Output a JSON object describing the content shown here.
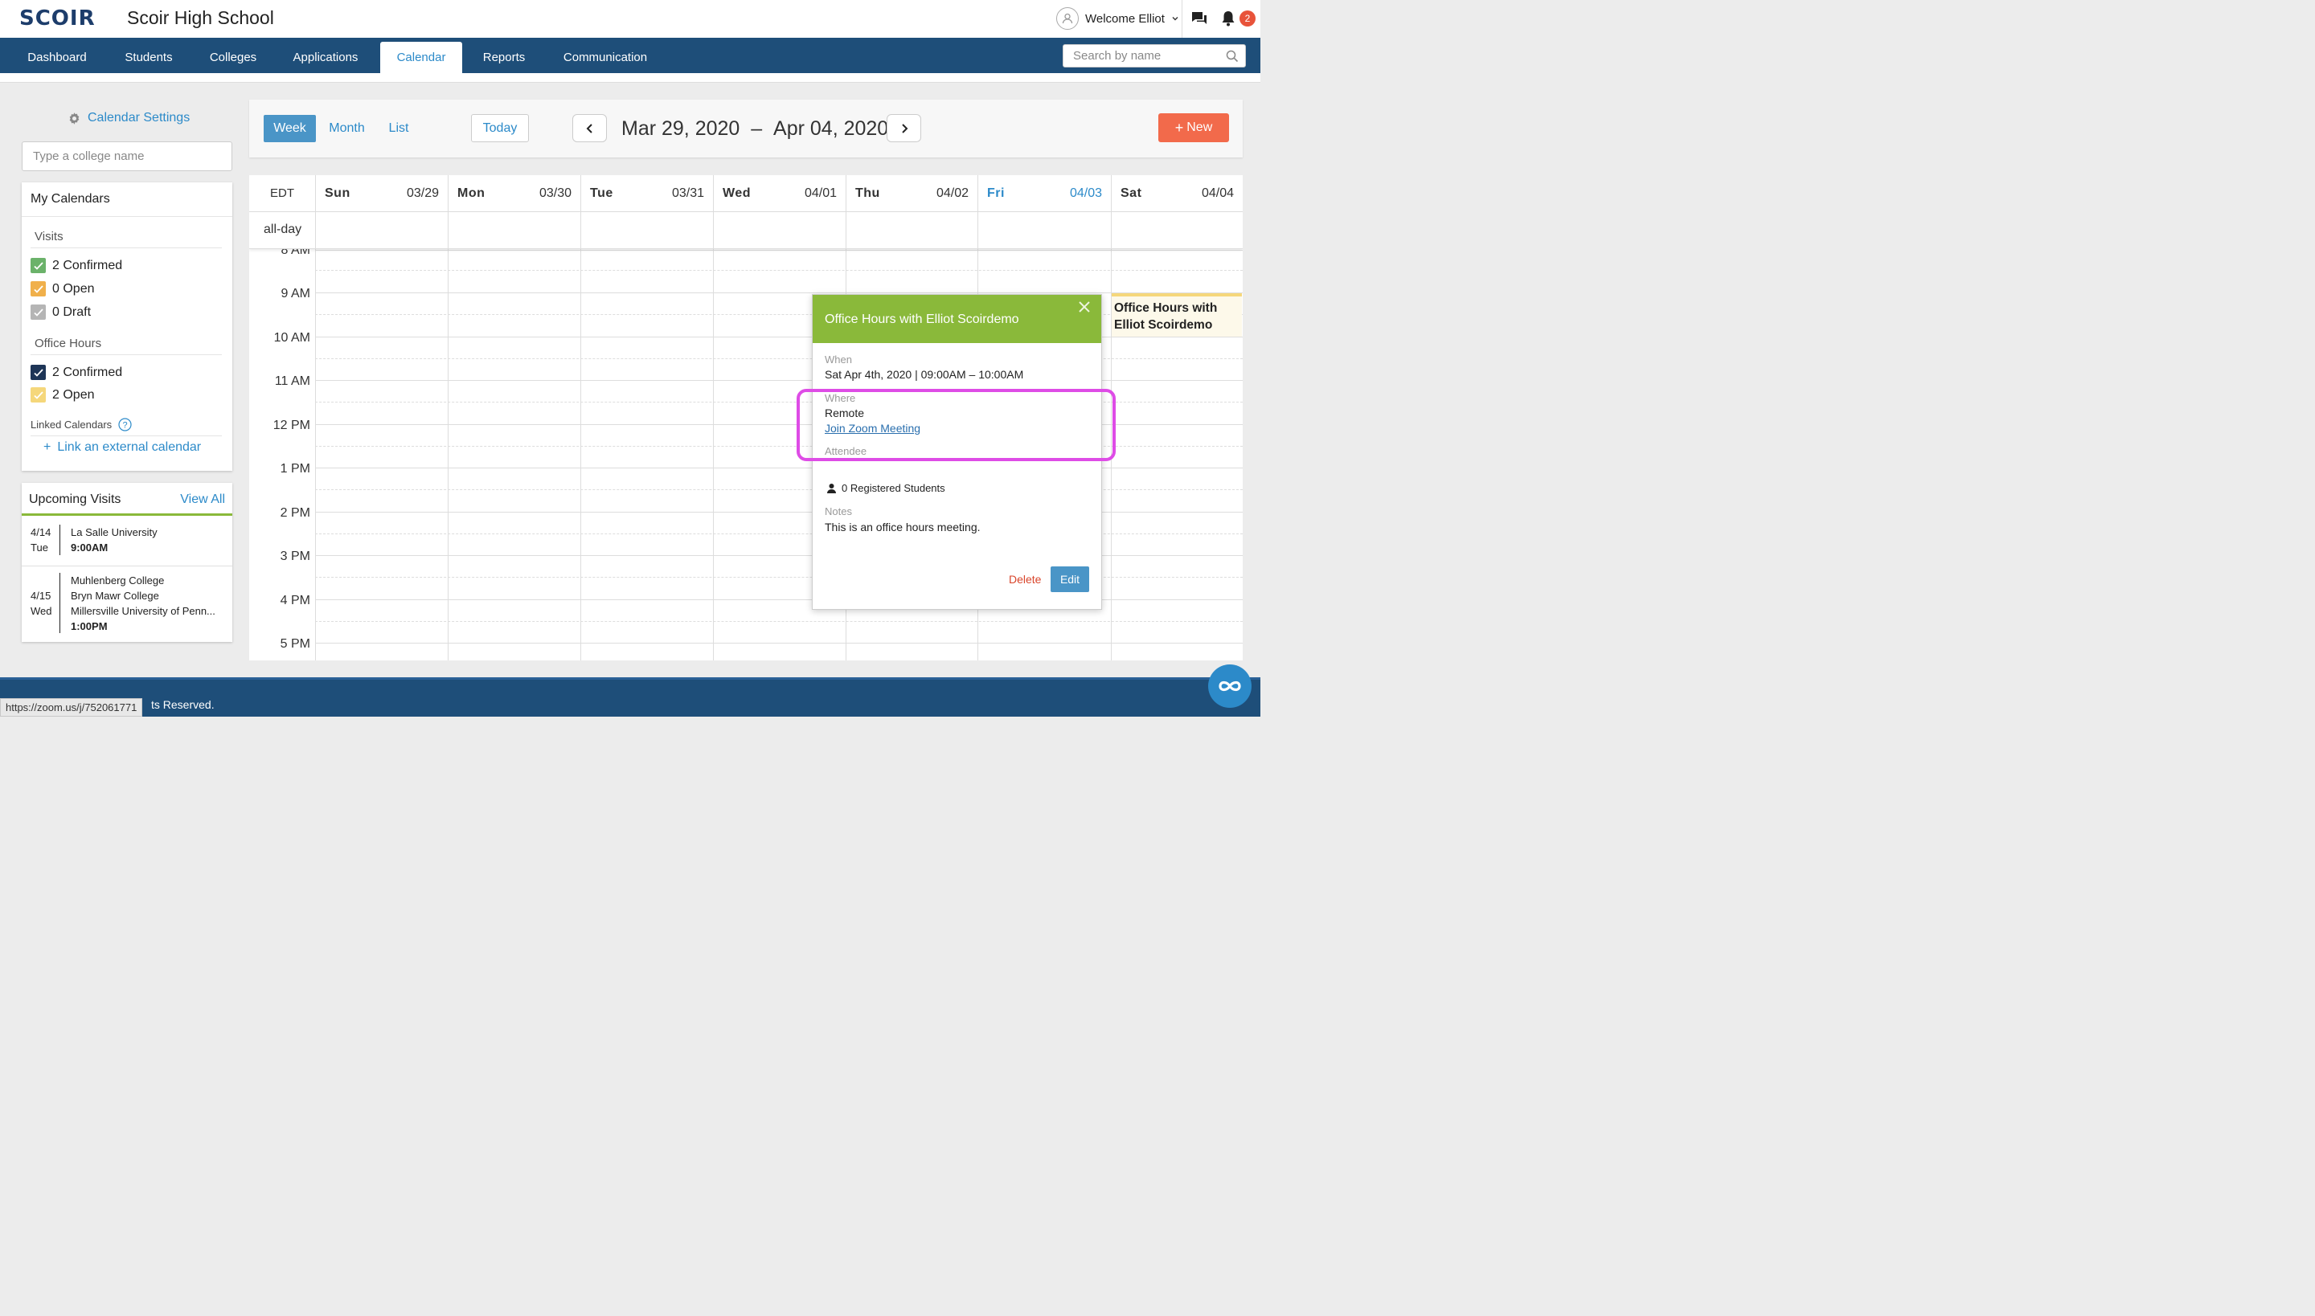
{
  "header": {
    "logo": "SCOIR",
    "school_name": "Scoir High School",
    "welcome": "Welcome Elliot",
    "notification_count": "2"
  },
  "nav": {
    "items": [
      {
        "label": "Dashboard"
      },
      {
        "label": "Students"
      },
      {
        "label": "Colleges"
      },
      {
        "label": "Applications"
      },
      {
        "label": "Calendar",
        "active": true
      },
      {
        "label": "Reports"
      },
      {
        "label": "Communication"
      }
    ],
    "search_placeholder": "Search by name"
  },
  "sidebar": {
    "calendar_settings": "Calendar Settings",
    "college_input_placeholder": "Type a college name",
    "my_calendars": {
      "title": "My Calendars",
      "visits_label": "Visits",
      "visits": [
        {
          "label": "2 Confirmed",
          "color": "#6bb26a"
        },
        {
          "label": "0 Open",
          "color": "#f0b04b"
        },
        {
          "label": "0 Draft",
          "color": "#b5b5b5"
        }
      ],
      "office_hours_label": "Office Hours",
      "office_hours": [
        {
          "label": "2 Confirmed",
          "color": "#1e3557"
        },
        {
          "label": "2 Open",
          "color": "#f5d77b"
        }
      ],
      "linked_label": "Linked Calendars",
      "link_external": "Link an external calendar"
    },
    "upcoming": {
      "title": "Upcoming Visits",
      "view_all": "View All",
      "items": [
        {
          "date": "4/14",
          "day": "Tue",
          "names": [
            "La Salle University"
          ],
          "time": "9:00AM"
        },
        {
          "date": "4/15",
          "day": "Wed",
          "names": [
            "Muhlenberg College",
            "Bryn Mawr College",
            "Millersville University of Penn..."
          ],
          "time": "1:00PM"
        }
      ]
    }
  },
  "toolbar": {
    "views": [
      "Week",
      "Month",
      "List"
    ],
    "active_view": "Week",
    "today": "Today",
    "range_start": "Mar 29, 2020",
    "range_sep": "–",
    "range_end": "Apr 04, 2020",
    "new_label": "New"
  },
  "grid": {
    "timezone": "EDT",
    "allday": "all-day",
    "days": [
      {
        "name": "Sun",
        "date": "03/29"
      },
      {
        "name": "Mon",
        "date": "03/30"
      },
      {
        "name": "Tue",
        "date": "03/31"
      },
      {
        "name": "Wed",
        "date": "04/01"
      },
      {
        "name": "Thu",
        "date": "04/02"
      },
      {
        "name": "Fri",
        "date": "04/03",
        "today": true
      },
      {
        "name": "Sat",
        "date": "04/04"
      }
    ],
    "hours": [
      "8 AM",
      "9 AM",
      "10 AM",
      "11 AM",
      "12 PM",
      "1 PM",
      "2 PM",
      "3 PM",
      "4 PM",
      "5 PM"
    ],
    "event_sat": "Office Hours with Elliot Scoirdemo"
  },
  "popover": {
    "title": "Office Hours with Elliot Scoirdemo",
    "when_label": "When",
    "when_value": "Sat Apr 4th, 2020 | 09:00AM – 10:00AM",
    "where_label": "Where",
    "where_value": "Remote",
    "zoom_link": "Join Zoom Meeting",
    "attendee_label": "Attendee",
    "attendee_value": "0 Registered Students",
    "notes_label": "Notes",
    "notes_value": "This is an office hours meeting.",
    "delete": "Delete",
    "edit": "Edit"
  },
  "footer": {
    "text": "ts Reserved.",
    "status_url": "https://zoom.us/j/752061771"
  }
}
